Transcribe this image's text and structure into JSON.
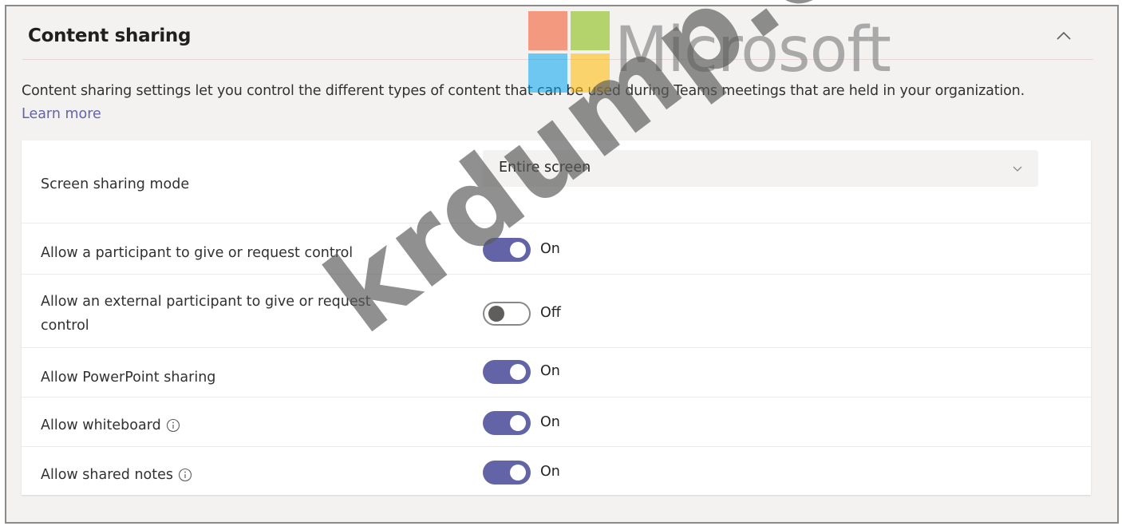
{
  "section": {
    "title": "Content sharing",
    "description": "Content sharing settings let you control the different types of content that can be used during Teams meetings that are held in your organization.",
    "learn_more": "Learn more"
  },
  "settings": {
    "screen_sharing": {
      "label": "Screen sharing mode",
      "value": "Entire screen"
    },
    "give_request_control": {
      "label": "Allow a participant to give or request control",
      "state": "On"
    },
    "external_give_request_control": {
      "label_line1": "Allow an external participant to give or request",
      "label_line2": "control",
      "state": "Off"
    },
    "powerpoint_sharing": {
      "label": "Allow PowerPoint sharing",
      "state": "On"
    },
    "whiteboard": {
      "label": "Allow whiteboard",
      "state": "On"
    },
    "shared_notes": {
      "label": "Allow shared notes",
      "state": "On"
    }
  },
  "watermarks": {
    "brand": "Microsoft",
    "site": "krdump.com"
  },
  "colors": {
    "accent": "#6264a7",
    "ms_red": "#f25022",
    "ms_green": "#7fba00",
    "ms_blue": "#00a4ef",
    "ms_yellow": "#ffb900"
  },
  "icons": [
    "chevron-up-icon",
    "chevron-down-icon",
    "info-icon"
  ]
}
